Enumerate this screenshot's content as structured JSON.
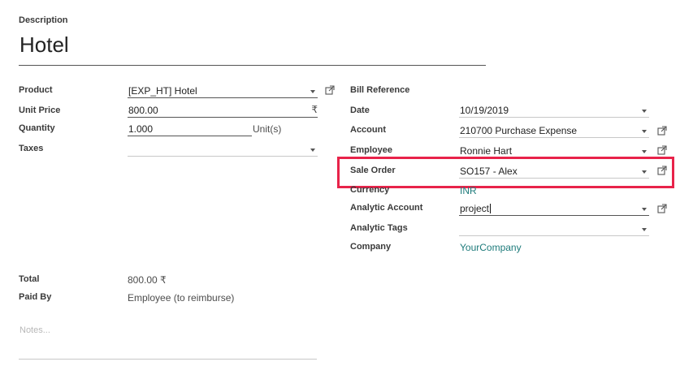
{
  "description": {
    "label": "Description",
    "value": "Hotel"
  },
  "left": {
    "product": {
      "label": "Product",
      "value": "[EXP_HT] Hotel"
    },
    "unit_price": {
      "label": "Unit Price",
      "value": "800.00",
      "currency_symbol": "₹"
    },
    "quantity": {
      "label": "Quantity",
      "value": "1.000",
      "uom": "Unit(s)"
    },
    "taxes": {
      "label": "Taxes",
      "value": ""
    },
    "total": {
      "label": "Total",
      "value": "800.00 ₹"
    },
    "paid_by": {
      "label": "Paid By",
      "value": "Employee (to reimburse)"
    },
    "notes": {
      "placeholder": "Notes..."
    }
  },
  "right": {
    "bill_reference": {
      "label": "Bill Reference",
      "value": ""
    },
    "date": {
      "label": "Date",
      "value": "10/19/2019"
    },
    "account": {
      "label": "Account",
      "value": "210700 Purchase Expense"
    },
    "employee": {
      "label": "Employee",
      "value": "Ronnie Hart"
    },
    "sale_order": {
      "label": "Sale Order",
      "value": "SO157 - Alex"
    },
    "currency": {
      "label": "Currency",
      "value": "INR"
    },
    "analytic_account": {
      "label": "Analytic Account",
      "value": "project"
    },
    "analytic_tags": {
      "label": "Analytic Tags",
      "value": ""
    },
    "company": {
      "label": "Company",
      "value": "YourCompany"
    }
  },
  "icons": {
    "dropdown": "caret-down-icon",
    "external": "external-link-icon"
  },
  "colors": {
    "highlight": "#e8234a",
    "link": "#1e7b7b"
  }
}
